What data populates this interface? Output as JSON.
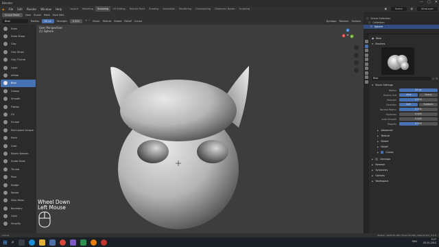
{
  "window": {
    "title": "Blender",
    "controls": [
      "—",
      "▢",
      "✕"
    ]
  },
  "menubar": {
    "app_menus": [
      "File",
      "Edit",
      "Render",
      "Window",
      "Help"
    ],
    "workspaces": [
      "Layout",
      "Modeling",
      "Sculpting",
      "UV Editing",
      "Texture Paint",
      "Shading",
      "Animation",
      "Rendering",
      "Compositing",
      "Geometry Nodes",
      "Scripting"
    ],
    "active_workspace": "Sculpting",
    "scene": "Scene",
    "view_layer": "ViewLayer"
  },
  "tool_header": {
    "mode": "Sculpt Mode",
    "mode_menus": [
      "View",
      "Sculpt",
      "Mask",
      "Face Sets"
    ],
    "brush_name": "Blob",
    "radius_label": "Radius",
    "radius_value": "85 px",
    "strength_label": "Strength",
    "strength_value": "0.500",
    "menus": [
      "Brush",
      "Texture",
      "Stroke",
      "Falloff",
      "Cursor"
    ],
    "dyntopo": "Dyntopo",
    "remesh": "Remesh",
    "options": "Options"
  },
  "toolbar": {
    "active": "Blob",
    "tools": [
      "Draw",
      "Draw Sharp",
      "Clay",
      "Clay Strips",
      "Clay Thumb",
      "Layer",
      "Inflate",
      "Blob",
      "Crease",
      "Smooth",
      "Flatten",
      "Fill",
      "Scrape",
      "Multi-plane Scrape",
      "Pinch",
      "Grab",
      "Elastic Deform",
      "Snake Hook",
      "Thumb",
      "Pose",
      "Nudge",
      "Rotate",
      "Slide Relax",
      "Boundary",
      "Cloth",
      "Simplify"
    ]
  },
  "viewport": {
    "view_name": "User Perspective",
    "object_name": "(1) Sphere",
    "overlay_line1": "Wheel Down",
    "overlay_line2": "Left Mouse",
    "axes": [
      "X",
      "Y",
      "Z"
    ]
  },
  "outliner": {
    "rows": [
      "Scene Collection",
      "Collection",
      "Sphere"
    ],
    "selected": "Sphere"
  },
  "properties": {
    "brush_header": "Blob",
    "brushes_label": "Brushes",
    "brush_slot": "Blob",
    "brush_settings_label": "Brush Settings",
    "radius": {
      "label": "Radius",
      "value": "85 px"
    },
    "radius_unit": {
      "label": "Radius Unit",
      "options": [
        "View",
        "Scene"
      ],
      "active": "View"
    },
    "strength": {
      "label": "Strength",
      "value": "0.500",
      "fraction": 0.5
    },
    "direction": {
      "label": "Direction",
      "options": [
        "Add",
        "Subtract"
      ],
      "active": "Add"
    },
    "normal_radius": {
      "label": "Normal Radius",
      "value": "0.500",
      "fraction": 0.5
    },
    "hardness": {
      "label": "Hardness",
      "value": "0.000",
      "fraction": 0.0
    },
    "auto_smooth": {
      "label": "Auto-Smooth",
      "value": "0.000",
      "fraction": 0.0
    },
    "magnify": {
      "label": "Magnify",
      "value": "0.500",
      "fraction": 0.5
    },
    "sub_sections": [
      "Advanced",
      "Texture",
      "Stroke",
      "Falloff",
      "Cursor"
    ],
    "cursor_checked": true,
    "sections": [
      "Dyntopo",
      "Remesh",
      "Symmetry",
      "Options",
      "Workspace"
    ]
  },
  "statusbar": {
    "left": "Cancel",
    "right": "Sphere | Verts:32,768 | Faces:32,768 | Objects:0/1 | 3.2.0"
  },
  "taskbar": {
    "time": "9:27",
    "date": "05.01.2024",
    "lang": "ENG"
  },
  "colors": {
    "accent": "#4772b3",
    "viewport_bg": "#3d3d3d",
    "panel_bg": "#2b2b2b",
    "header_bg": "#303030"
  }
}
